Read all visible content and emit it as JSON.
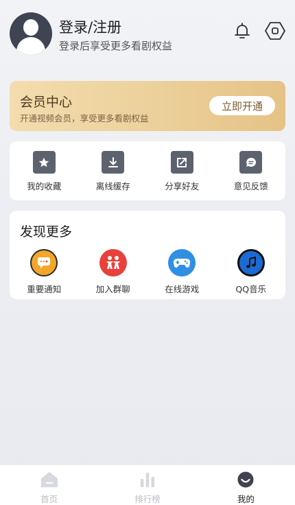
{
  "profile": {
    "title": "登录/注册",
    "subtitle": "登录后享受更多看剧权益"
  },
  "vip": {
    "title": "会员中心",
    "desc": "开通视频会员，享受更多看剧权益",
    "button": "立即开通"
  },
  "tools": [
    {
      "label": "我的收藏",
      "icon": "star-icon"
    },
    {
      "label": "离线缓存",
      "icon": "download-icon"
    },
    {
      "label": "分享好友",
      "icon": "share-icon"
    },
    {
      "label": "意见反馈",
      "icon": "feedback-icon"
    }
  ],
  "discover": {
    "title": "发现更多",
    "items": [
      {
        "label": "重要通知",
        "icon": "notice-chat-icon",
        "color": "#f3a72a"
      },
      {
        "label": "加入群聊",
        "icon": "group-icon",
        "color": "#e8403a"
      },
      {
        "label": "在线游戏",
        "icon": "gamepad-icon",
        "color": "#2f8fe3"
      },
      {
        "label": "QQ音乐",
        "icon": "music-icon",
        "color": "#1b6bd4"
      }
    ]
  },
  "tabbar": [
    {
      "label": "首页",
      "icon": "home-icon",
      "active": false
    },
    {
      "label": "排行榜",
      "icon": "ranking-icon",
      "active": false
    },
    {
      "label": "我的",
      "icon": "profile-icon",
      "active": true
    }
  ]
}
